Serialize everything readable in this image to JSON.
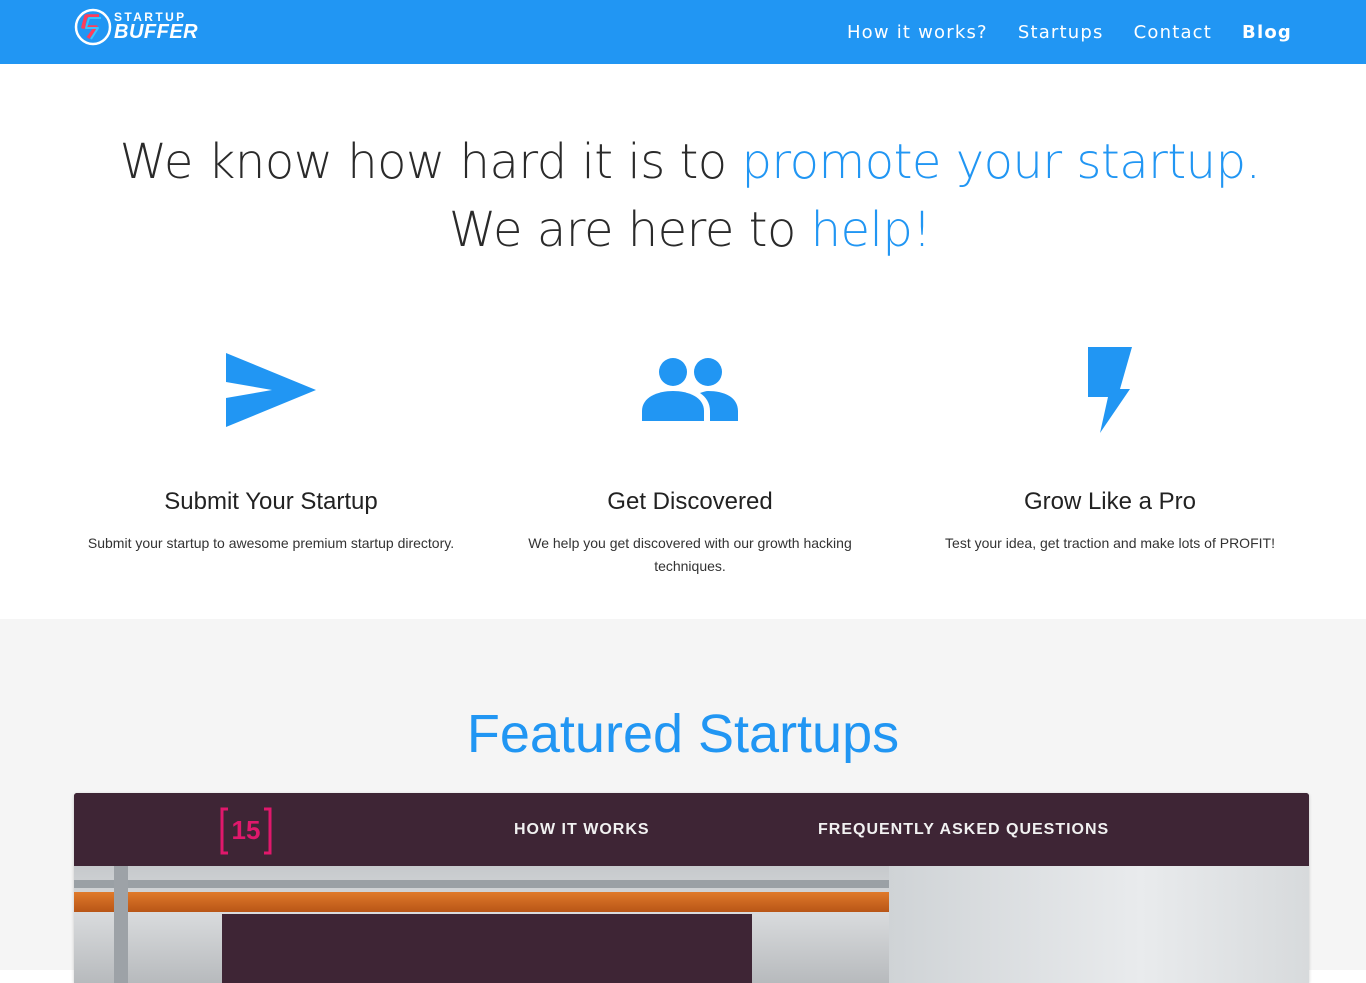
{
  "brand": {
    "logo_top": "STARTUP",
    "logo_bottom": "BUFFER",
    "primary_color": "#2196f3"
  },
  "nav": {
    "links": [
      {
        "label": "How it works?"
      },
      {
        "label": "Startups"
      },
      {
        "label": "Contact"
      },
      {
        "label": "Blog"
      }
    ]
  },
  "hero": {
    "part1": "We know how hard it is to ",
    "accent1": "promote your startup.",
    "part2": " We are here to ",
    "accent2": "help!"
  },
  "features": [
    {
      "icon": "send-icon",
      "title": "Submit Your Startup",
      "text": "Submit your startup to awesome premium startup directory."
    },
    {
      "icon": "people-icon",
      "title": "Get Discovered",
      "text": "We help you get discovered with our growth hacking techniques."
    },
    {
      "icon": "lightning-icon",
      "title": "Grow Like a Pro",
      "text": "Test your idea, get traction and make lots of PROFIT!"
    }
  ],
  "featured": {
    "heading": "Featured Startups",
    "preview": {
      "logo_text": "15",
      "links": [
        "HOW IT WORKS",
        "FREQUENTLY ASKED QUESTIONS"
      ]
    }
  }
}
